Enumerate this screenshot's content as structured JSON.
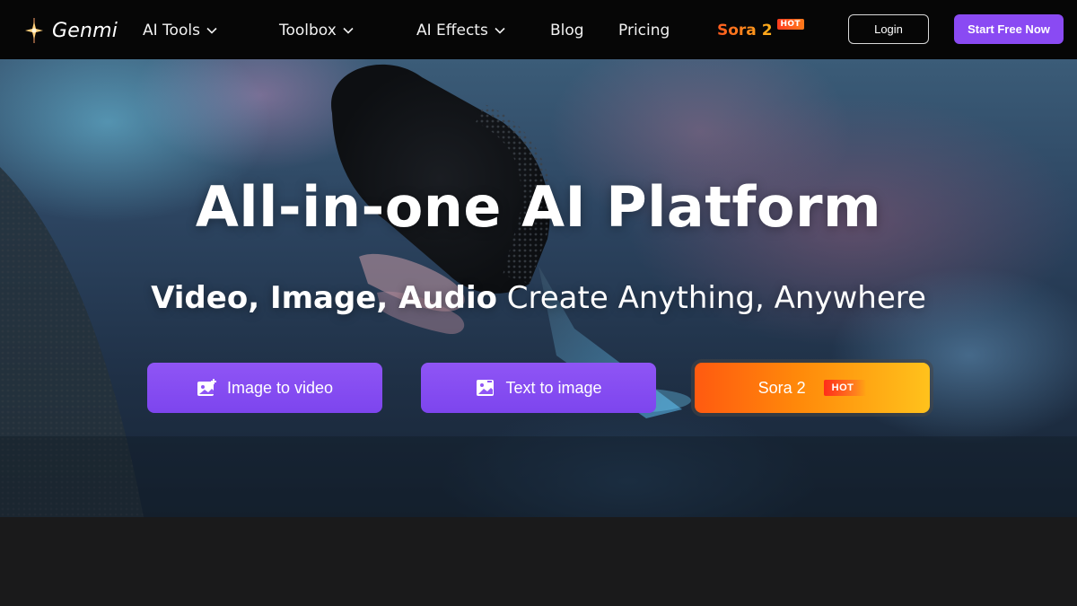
{
  "nav": {
    "logo_text": "Genmi",
    "items": [
      {
        "label": "AI Tools",
        "dropdown": true
      },
      {
        "label": "Toolbox",
        "dropdown": true
      },
      {
        "label": "AI Effects",
        "dropdown": true
      },
      {
        "label": "Blog",
        "dropdown": false
      },
      {
        "label": "Pricing",
        "dropdown": false
      }
    ],
    "sora": {
      "label": "Sora 2",
      "badge": "HOT"
    },
    "login_label": "Login",
    "start_label": "Start Free Now"
  },
  "hero": {
    "title": "All-in-one AI Platform",
    "subtitle_bold": "Video, Image, Audio",
    "subtitle_rest": " Create Anything, Anywhere",
    "buttons": [
      {
        "label": "Image to video",
        "icon": "image-to-video-icon"
      },
      {
        "label": "Text to image",
        "icon": "text-to-image-icon"
      },
      {
        "label": "Sora 2",
        "badge": "HOT"
      }
    ]
  },
  "colors": {
    "nav_bg": "#060606",
    "accent_purple": "#8a4af3",
    "sora_gradient_start": "#ff5a10",
    "sora_gradient_end": "#ffc21c",
    "page_bg": "#1a1a1b"
  }
}
